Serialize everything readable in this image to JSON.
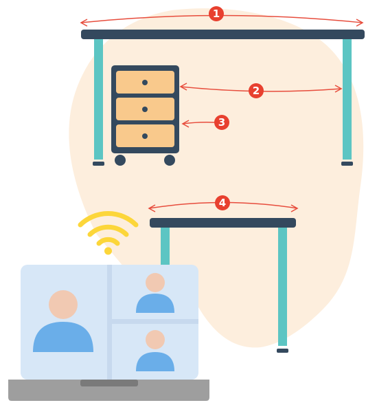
{
  "colors": {
    "blob": "#fdeedd",
    "desk_top": "#34495e",
    "desk_leg": "#5cc5c3",
    "cabinet_frame": "#34495e",
    "drawer": "#f9c98c",
    "knob": "#34495e",
    "arrow": "#e74c3c",
    "marker": "#e8402f",
    "wifi": "#fcd63a",
    "screen": "#d7e7f7",
    "person_head": "#f1c9b2",
    "person_body": "#6aaee9",
    "laptop_base": "#9e9e9e",
    "laptop_notch": "#7a7a7a"
  },
  "markers": [
    {
      "id": "desk-width",
      "label": "1"
    },
    {
      "id": "desk-depth-to-cabinet",
      "label": "2"
    },
    {
      "id": "cabinet-depth",
      "label": "3"
    },
    {
      "id": "small-desk-width",
      "label": "4"
    }
  ],
  "icons": {
    "wifi": "wifi-icon",
    "laptop": "laptop-icon",
    "participant": "person-icon"
  }
}
